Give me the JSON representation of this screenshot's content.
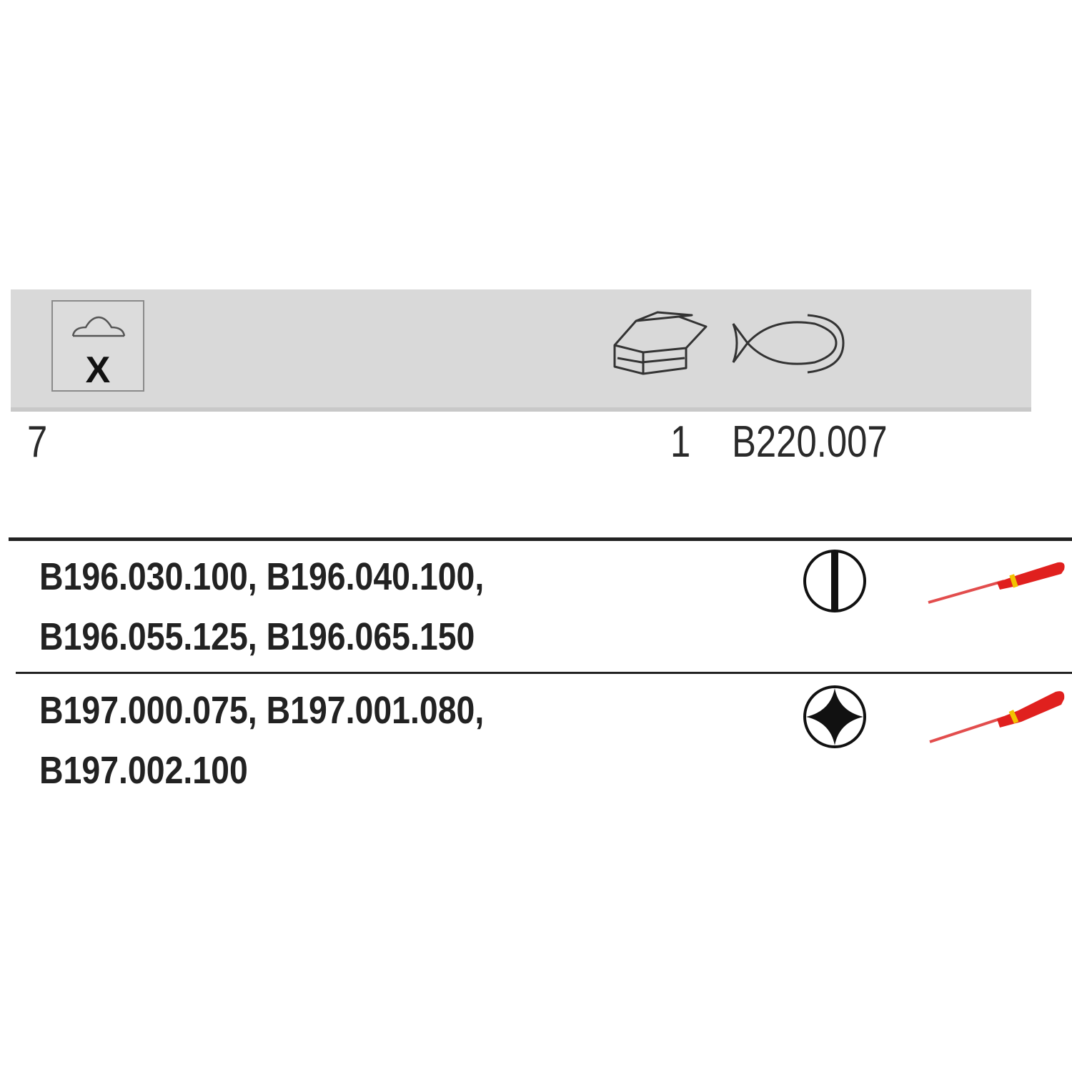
{
  "header": {
    "set_qty_marker": "X",
    "icons": [
      "hanger-pack-icon",
      "box-pack-icon",
      "fish-pack-icon"
    ]
  },
  "summary_row": {
    "set_qty": "7",
    "pack_qty": "1",
    "article": "B220.007"
  },
  "items": [
    {
      "codes_line1": "B196.030.100, B196.040.100,",
      "codes_line2": "B196.055.125, B196.065.150",
      "tip_icon": "slotted-tip-icon",
      "tool_icon": "screwdriver-icon"
    },
    {
      "codes_line1": "B197.000.075, B197.001.080,",
      "codes_line2": "B197.002.100",
      "tip_icon": "phillips-tip-icon",
      "tool_icon": "screwdriver-icon"
    }
  ],
  "colors": {
    "header_band": "#d9d9d9",
    "handle_red": "#e0201e",
    "handle_yellow": "#f2c200"
  }
}
